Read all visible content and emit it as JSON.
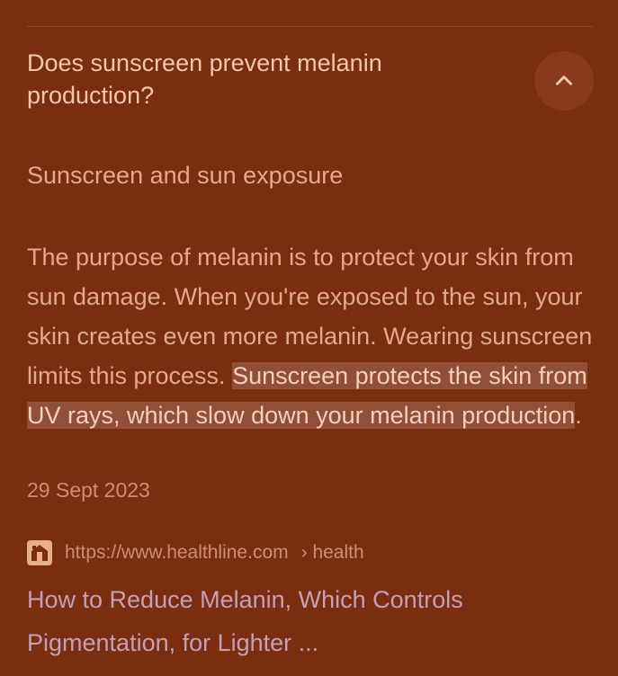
{
  "question": "Does sunscreen prevent melanin production?",
  "collapse_icon": "chevron-up-icon",
  "subheading": "Sunscreen and sun exposure",
  "answer": {
    "plain": "The purpose of melanin is to protect your skin from sun damage. When you're exposed to the sun, your skin creates even more melanin. Wearing sunscreen limits this process.",
    "highlighted": "Sunscreen protects the skin from UV rays, which slow down your melanin production",
    "trailing": "."
  },
  "date": "29 Sept 2023",
  "source": {
    "favicon": "healthline-logo-icon",
    "url": "https://www.healthline.com",
    "path": "› health"
  },
  "result_title": "How to Reduce Melanin, Which Controls Pigmentation, for Lighter ...",
  "colors": {
    "background": "#7b2d10",
    "heading": "#f1c8ad",
    "body_text": "#e2a98d",
    "highlight_bg": "#924f37",
    "link": "#c4a0b8"
  }
}
